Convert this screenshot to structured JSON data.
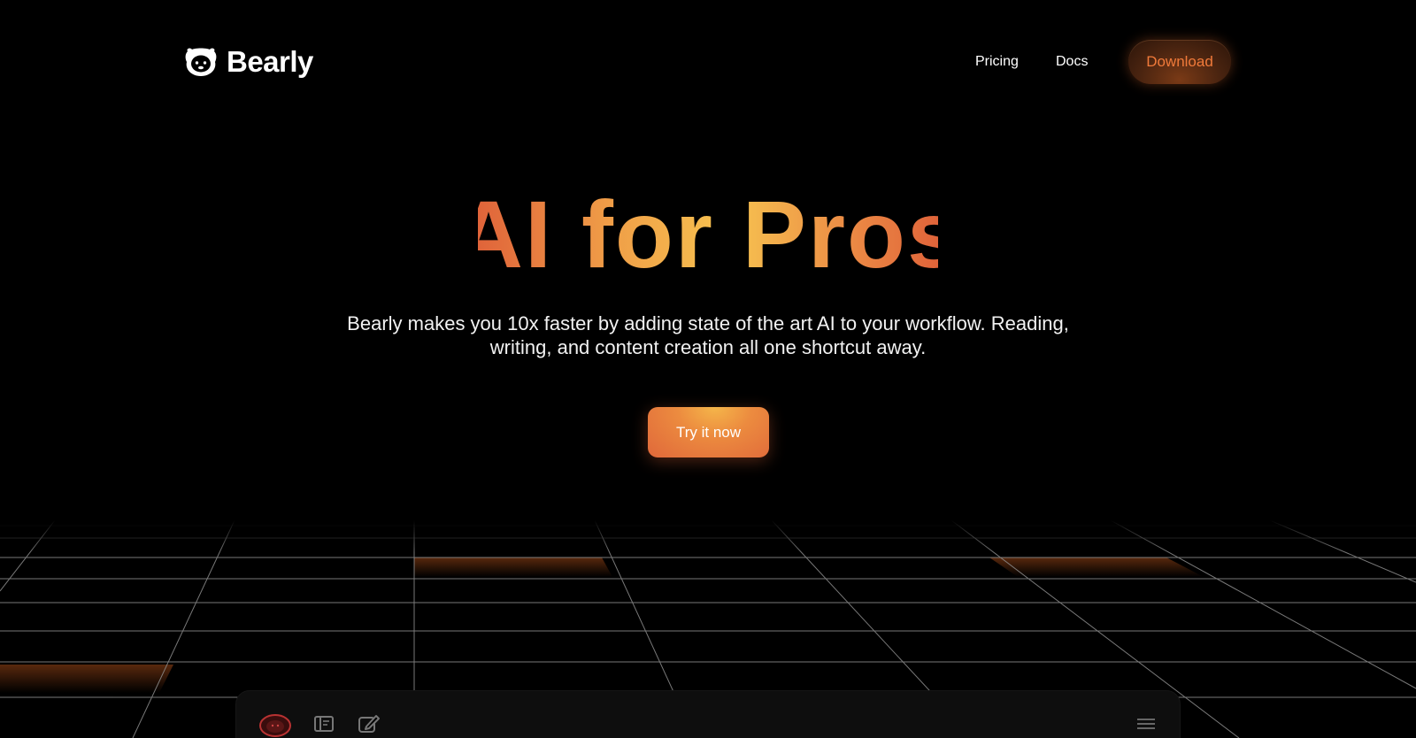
{
  "header": {
    "brand_name": "Bearly",
    "logo_icon": "bear-face-icon",
    "nav": {
      "pricing_label": "Pricing",
      "docs_label": "Docs",
      "download_label": "Download"
    }
  },
  "hero": {
    "title": "AI for Pros",
    "subtitle": "Bearly makes you 10x faster by adding state of the art AI to your workflow. Reading, writing, and content creation all one shortcut away.",
    "cta_label": "Try it now"
  },
  "app_preview": {
    "icons": [
      "bear-avatar-icon",
      "book-icon",
      "edit-icon",
      "menu-icon"
    ]
  },
  "colors": {
    "background": "#000000",
    "accent_orange": "#e0683a",
    "accent_yellow": "#f7c350",
    "download_text": "#f07a3a"
  }
}
